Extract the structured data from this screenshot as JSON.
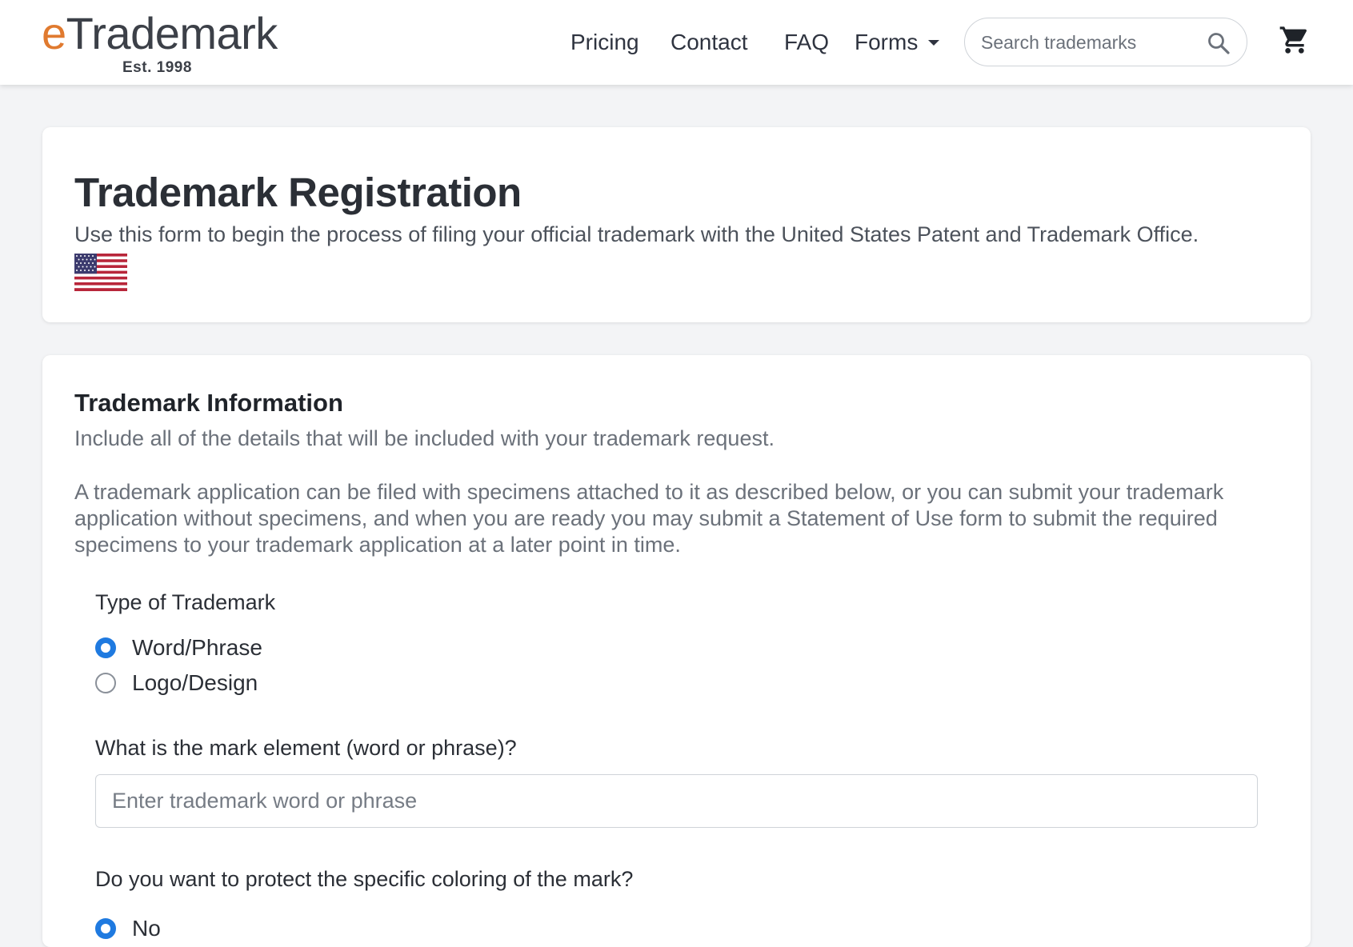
{
  "brand": {
    "name_first_letter": "e",
    "name_rest": "Trademark",
    "tagline": "Est. 1998",
    "accent_color": "#e07a2f"
  },
  "nav": {
    "items": [
      {
        "label": "Pricing"
      },
      {
        "label": "Contact"
      },
      {
        "label": "FAQ"
      },
      {
        "label": "Forms",
        "has_dropdown": true
      }
    ]
  },
  "search": {
    "placeholder": "Search trademarks",
    "icon": "search-icon"
  },
  "cart": {
    "icon": "cart-icon"
  },
  "header_card": {
    "title": "Trademark Registration",
    "subtitle": "Use this form to begin the process of filing your official trademark with the United States Patent and Trademark Office.",
    "flag_icon": "us-flag-icon"
  },
  "info_section": {
    "title": "Trademark Information",
    "description": "Include all of the details that will be included with your trademark request.",
    "description2": "A trademark application can be filed with specimens attached to it as described below, or you can submit your trademark application without specimens, and when you are ready you may submit a Statement of Use form to submit the required specimens to your trademark application at a later point in time.",
    "type_label": "Type of Trademark",
    "type_options": [
      {
        "label": "Word/Phrase",
        "checked": true
      },
      {
        "label": "Logo/Design",
        "checked": false
      }
    ],
    "mark_label": "What is the mark element (word or phrase)?",
    "mark_placeholder": "Enter trademark word or phrase",
    "color_label": "Do you want to protect the specific coloring of the mark?",
    "color_options": [
      {
        "label": "No",
        "checked": true
      }
    ],
    "accent_color": "#1f7ae0"
  }
}
